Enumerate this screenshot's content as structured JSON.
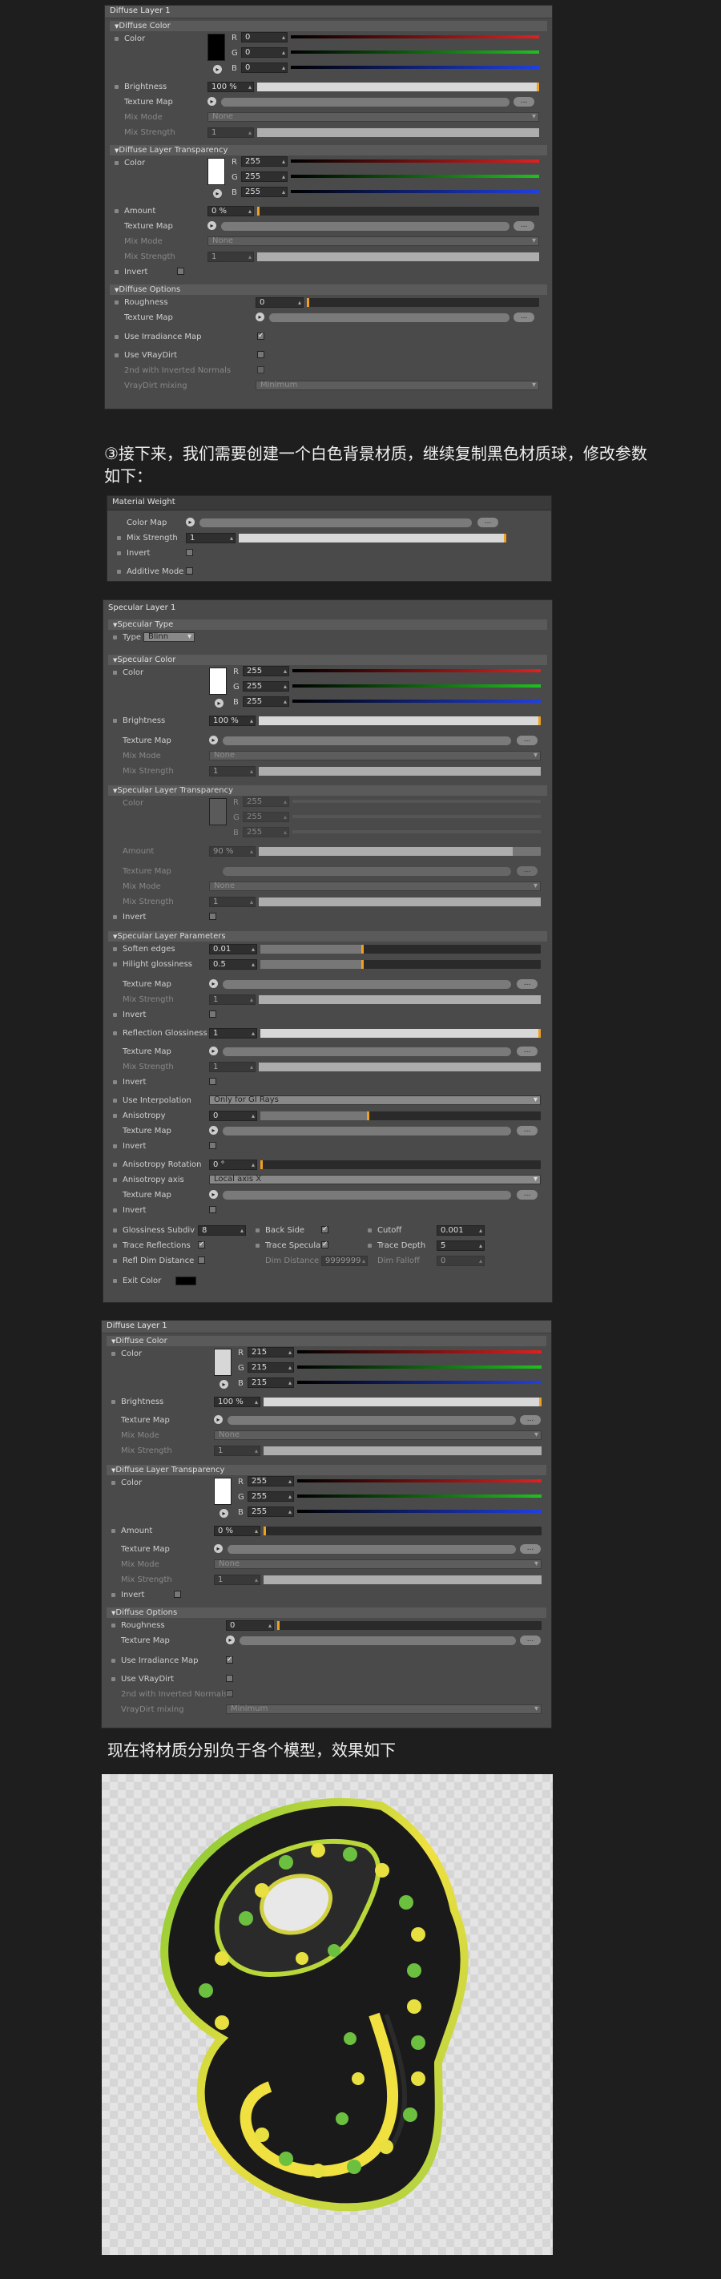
{
  "panel1": {
    "title": "Diffuse Layer 1",
    "s1": "Diffuse Color",
    "color_label": "Color",
    "r": "0",
    "g": "0",
    "b": "0",
    "R": "R",
    "G": "G",
    "B": "B",
    "brightness_label": "Brightness",
    "brightness": "100 %",
    "texture_map": "Texture Map",
    "mix_mode": "Mix Mode",
    "mix_mode_val": "None",
    "mix_strength": "Mix Strength",
    "mix_strength_val": "1",
    "s2": "Diffuse Layer Transparency",
    "color2_label": "Color",
    "r2": "255",
    "g2": "255",
    "b2": "255",
    "amount_label": "Amount",
    "amount": "0 %",
    "texture_map2": "Texture Map",
    "mix_mode2": "Mix Mode",
    "mix_mode2_val": "None",
    "mix_strength2": "Mix Strength",
    "mix_strength2_val": "1",
    "invert": "Invert",
    "s3": "Diffuse Options",
    "roughness_label": "Roughness",
    "roughness": "0",
    "texture_map3": "Texture Map",
    "use_irradiance": "Use Irradiance Map",
    "use_vraydirt": "Use VRayDirt",
    "dirt_inverted": "2nd with Inverted Normals",
    "vraydirt_mixing": "VrayDirt mixing",
    "vraydirt_mixing_val": "Minimum",
    "dots": "..."
  },
  "text1": "③接下来，我们需要创建一个白色背景材质，继续复制黑色材质球，修改参数如下：",
  "panel2": {
    "title": "Material Weight",
    "color_map": "Color Map",
    "mix_strength": "Mix Strength",
    "mix_strength_val": "1",
    "invert": "Invert",
    "additive": "Additive Mode",
    "dots": "..."
  },
  "panel3": {
    "title": "Specular Layer 1",
    "s1": "Specular Type",
    "type_label": "Type",
    "type_val": "Blinn",
    "s2": "Specular Color",
    "color_label": "Color",
    "r": "255",
    "g": "255",
    "b": "255",
    "R": "R",
    "G": "G",
    "B": "B",
    "brightness_label": "Brightness",
    "brightness": "100 %",
    "texture_map": "Texture Map",
    "mix_mode": "Mix Mode",
    "mix_mode_val": "None",
    "mix_strength": "Mix Strength",
    "mix_strength_val": "1",
    "s3": "Specular Layer Transparency",
    "color2_label": "Color",
    "r2": "255",
    "g2": "255",
    "b2": "255",
    "amount_label": "Amount",
    "amount": "90 %",
    "texture_map2": "Texture Map",
    "mix_mode2": "Mix Mode",
    "mix_mode2_val": "None",
    "mix_strength2": "Mix Strength",
    "mix_strength2_val": "1",
    "invert": "Invert",
    "s4": "Specular Layer Parameters",
    "soften": "Soften edges",
    "soften_val": "0.01",
    "hilight": "Hilight glossiness",
    "hilight_val": "0.5",
    "texture_map3": "Texture Map",
    "mix_strength3": "Mix Strength",
    "mix_strength3_val": "1",
    "invert3": "Invert",
    "refl": "Reflection Glossiness",
    "refl_val": "1",
    "texture_map4": "Texture Map",
    "mix_strength4": "Mix Strength",
    "mix_strength4_val": "1",
    "invert4": "Invert",
    "interp": "Use Interpolation",
    "interp_val": "Only for GI Rays",
    "aniso": "Anisotropy",
    "aniso_val": "0",
    "texture_map5": "Texture Map",
    "invert5": "Invert",
    "aniso_rot": "Anisotropy Rotation",
    "aniso_rot_val": "0 °",
    "aniso_axis": "Anisotropy axis",
    "aniso_axis_val": "Local axis X",
    "texture_map6": "Texture Map",
    "invert6": "Invert",
    "gloss_sub": "Glossiness Subdiv",
    "gloss_sub_val": "8",
    "back_side": "Back Side",
    "cutoff": "Cutoff",
    "cutoff_val": "0.001",
    "trace_refl": "Trace Reflections",
    "trace_spec": "Trace Specular",
    "trace_depth": "Trace Depth",
    "trace_depth_val": "5",
    "refl_dim": "Refl Dim Distance",
    "dim_distance": "Dim Distance",
    "dim_distance_val": "9999999",
    "dim_falloff": "Dim Falloff",
    "dim_falloff_val": "0",
    "exit_color": "Exit Color",
    "dots": "..."
  },
  "panel4": {
    "title": "Diffuse Layer 1",
    "s1": "Diffuse Color",
    "color_label": "Color",
    "r": "215",
    "g": "215",
    "b": "215",
    "R": "R",
    "G": "G",
    "B": "B",
    "brightness_label": "Brightness",
    "brightness": "100 %",
    "texture_map": "Texture Map",
    "mix_mode": "Mix Mode",
    "mix_mode_val": "None",
    "mix_strength": "Mix Strength",
    "mix_strength_val": "1",
    "s2": "Diffuse Layer Transparency",
    "color2_label": "Color",
    "r2": "255",
    "g2": "255",
    "b2": "255",
    "amount_label": "Amount",
    "amount": "0 %",
    "texture_map2": "Texture Map",
    "mix_mode2": "Mix Mode",
    "mix_mode2_val": "None",
    "mix_strength2": "Mix Strength",
    "mix_strength2_val": "1",
    "invert": "Invert",
    "s3": "Diffuse Options",
    "roughness_label": "Roughness",
    "roughness": "0",
    "texture_map3": "Texture Map",
    "use_irradiance": "Use Irradiance Map",
    "use_vraydirt": "Use VRayDirt",
    "dirt_inverted": "2nd with Inverted Normals",
    "vraydirt_mixing": "VrayDirt mixing",
    "vraydirt_mixing_val": "Minimum",
    "dots": "..."
  },
  "text2": "现在将材质分别负于各个模型，效果如下"
}
